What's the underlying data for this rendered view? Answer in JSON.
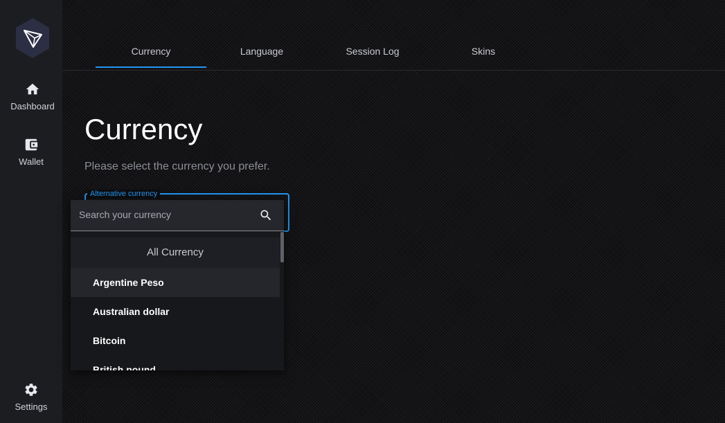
{
  "sidebar": {
    "items": [
      {
        "label": "Dashboard",
        "icon": "home-icon"
      },
      {
        "label": "Wallet",
        "icon": "wallet-icon"
      },
      {
        "label": "Settings",
        "icon": "gear-icon"
      }
    ]
  },
  "tabs": [
    {
      "label": "Currency",
      "active": true
    },
    {
      "label": "Language"
    },
    {
      "label": "Session Log"
    },
    {
      "label": "Skins"
    }
  ],
  "main": {
    "title": "Currency",
    "subtitle": "Please select the currency you prefer."
  },
  "currency_select": {
    "label": "Alternative currency",
    "search_placeholder": "Search your currency",
    "group_header": "All Currency",
    "options": [
      "Argentine Peso",
      "Australian dollar",
      "Bitcoin",
      "British pound"
    ]
  },
  "colors": {
    "accent": "#2196f3",
    "sidebar_bg": "#1c1d21",
    "page_bg": "#0d0d0f"
  }
}
